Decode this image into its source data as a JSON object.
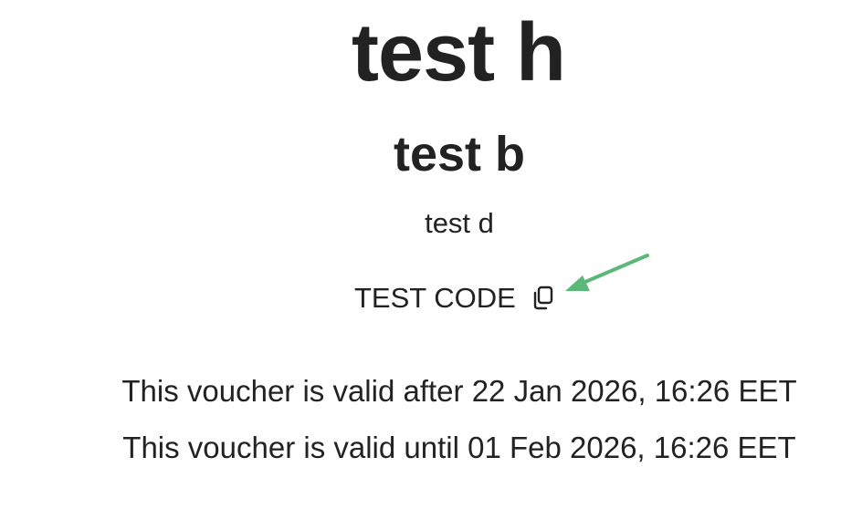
{
  "voucher": {
    "heading": "test h",
    "body": "test b",
    "description": "test d",
    "code": "TEST CODE",
    "copy_icon": "copy-icon",
    "annotation_arrow_color": "#5cb879",
    "valid_after": "This voucher is valid after 22 Jan 2026, 16:26 EET",
    "valid_until": "This voucher is valid until 01 Feb 2026, 16:26 EET"
  }
}
